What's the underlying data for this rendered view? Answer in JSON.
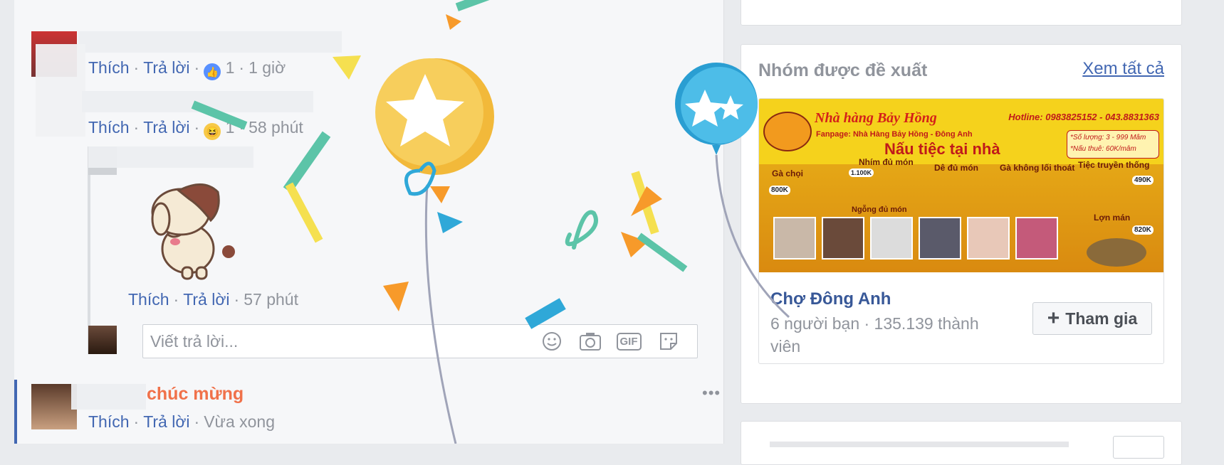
{
  "comments": [
    {
      "actions": {
        "like": "Thích",
        "reply": "Trả lời",
        "reaction_count": "1",
        "time": "1 giờ"
      }
    },
    {
      "actions": {
        "like": "Thích",
        "reply": "Trả lời",
        "reaction_count": "1",
        "time": "58 phút"
      }
    },
    {
      "actions": {
        "like": "Thích",
        "reply": "Trả lời",
        "time": "57 phút"
      }
    },
    {
      "highlight": "chúc mừng",
      "actions": {
        "like": "Thích",
        "reply": "Trả lời",
        "time": "Vừa xong"
      }
    }
  ],
  "reply_input": {
    "placeholder": "Viết trả lời...",
    "gif_label": "GIF"
  },
  "suggested_groups": {
    "title": "Nhóm được đề xuất",
    "see_all": "Xem tất cả",
    "group": {
      "name": "Chợ Đông Anh",
      "meta": "6 người bạn · 135.139 thành viên",
      "join_label": "Tham gia",
      "join_icon": "+",
      "banner": {
        "headline": "Nấu tiệc tại nhà",
        "restaurant": "Nhà hàng Bảy Hồng",
        "fanpage": "Fanpage: Nhà Hàng Bảy Hồng - Đông Anh",
        "hotline": "Hotline: 0983825152 - 043.8831363",
        "qty": "*Số lượng: 3 - 999 Mâm",
        "price": "*Nấu thuê: 60K/mâm",
        "items": [
          "Gà chọi",
          "Nhím đủ món",
          "Dê đủ món",
          "Gà không lối thoát",
          "Tiệc truyền thống",
          "Ngỗng đủ món",
          "Lợn mán"
        ],
        "prices": [
          "800K",
          "1.100K",
          "490K",
          "820K"
        ]
      }
    }
  },
  "colors": {
    "link": "#4267b2",
    "muted": "#90949c",
    "highlight": "#f0714a",
    "banner": "#f5d21c"
  }
}
